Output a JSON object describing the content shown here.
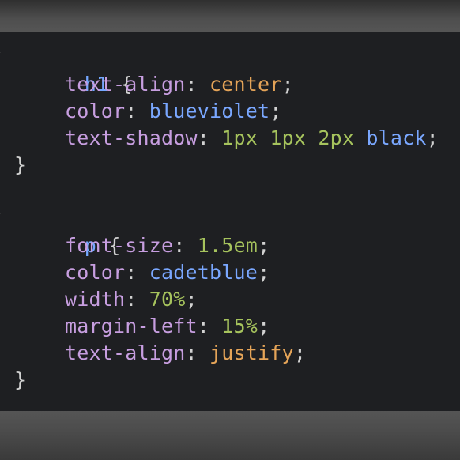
{
  "colors": {
    "background": "#1e1f22",
    "selector": "#74a7ff",
    "property": "#c79ee0",
    "keyword_value": "#e5a458",
    "color_value": "#7aa7ff",
    "number_value": "#a6c35d",
    "punctuation": "#d2d2d2"
  },
  "code": {
    "rule1": {
      "selector": "h1",
      "open": "{",
      "decl1": {
        "prop": "text-align",
        "colon": ":",
        "value": "center",
        "semi": ";"
      },
      "decl2": {
        "prop": "color",
        "colon": ":",
        "value": "blueviolet",
        "semi": ";"
      },
      "decl3": {
        "prop": "text-shadow",
        "colon": ":",
        "v1": "1px",
        "v2": "1px",
        "v3": "2px",
        "v4": "black",
        "semi": ";"
      },
      "close": "}"
    },
    "rule2": {
      "selector": "p",
      "open": "{",
      "decl1": {
        "prop": "font-size",
        "colon": ":",
        "value": "1.5em",
        "semi": ";"
      },
      "decl2": {
        "prop": "color",
        "colon": ":",
        "value": "cadetblue",
        "semi": ";"
      },
      "decl3": {
        "prop": "width",
        "colon": ":",
        "value": "70%",
        "semi": ";"
      },
      "decl4": {
        "prop": "margin-left",
        "colon": ":",
        "value": "15%",
        "semi": ";"
      },
      "decl5": {
        "prop": "text-align",
        "colon": ":",
        "value": "justify",
        "semi": ";"
      },
      "close": "}"
    }
  }
}
